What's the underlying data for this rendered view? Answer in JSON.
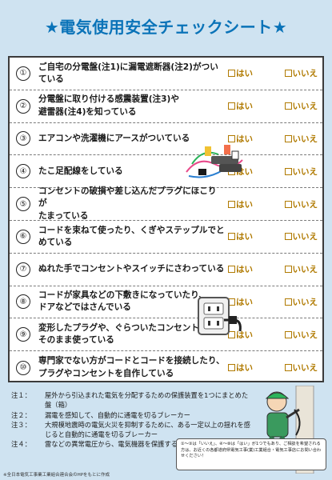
{
  "title": "★電気使用安全チェックシート★",
  "answers": {
    "yes": "はい",
    "no": "いいえ"
  },
  "items": [
    {
      "num": "①",
      "lines": [
        "ご自宅の分電盤(注1)に漏電遮断器(注2)がついている"
      ]
    },
    {
      "num": "②",
      "lines": [
        "分電盤に取り付ける感震装置(注3)や",
        "避雷器(注4)を知っている"
      ]
    },
    {
      "num": "③",
      "lines": [
        "エアコンや洗濯機にアースがついている"
      ]
    },
    {
      "num": "④",
      "lines": [
        "たこ足配線をしている"
      ]
    },
    {
      "num": "⑤",
      "lines": [
        "コンセントの破損や差し込んだプラグにほこりが",
        "たまっている"
      ]
    },
    {
      "num": "⑥",
      "lines": [
        "コードを束ねて使ったり、くぎやステップルでとめている"
      ]
    },
    {
      "num": "⑦",
      "lines": [
        "ぬれた手でコンセントやスイッチにさわっている"
      ]
    },
    {
      "num": "⑧",
      "lines": [
        "コードが家具などの下敷きになっていたり、",
        "ドアなどではさんでいる"
      ]
    },
    {
      "num": "⑨",
      "lines": [
        "変形したプラグや、ぐらついたコンセントを",
        "そのまま使っている"
      ]
    },
    {
      "num": "⑩",
      "lines": [
        "専門家でない方がコードとコードを接続したり、",
        "プラグやコンセントを自作している"
      ]
    }
  ],
  "notes": [
    {
      "label": "注１：",
      "text": "屋外から引込まれた電気を分配するための保護装置を1つにまとめた盤（箱）"
    },
    {
      "label": "注２：",
      "text": "漏電を感知して、自動的に通電を切るブレーカー"
    },
    {
      "label": "注３：",
      "text": "大規模地震時の電気火災を抑制するために、ある一定以上の揺れを感じると自動的に通電を切るブレーカー"
    },
    {
      "label": "注４：",
      "text": "雷などの異常電圧から、電気機器を保護する装置"
    }
  ],
  "bubble": "①〜③は「いいえ」、④〜⑩は「はい」が1つでもあり、ご相談を希望される方は、お近くの各都道府県電気工事(業)工業組合・電気工事店にお問い合わせください！",
  "footer": "※全日本電気工事業工業組合連合会のHPをもとに作成",
  "colors": {
    "title": "#0a73b8",
    "background": "#cfe3f1",
    "answer": "#b07a00"
  }
}
